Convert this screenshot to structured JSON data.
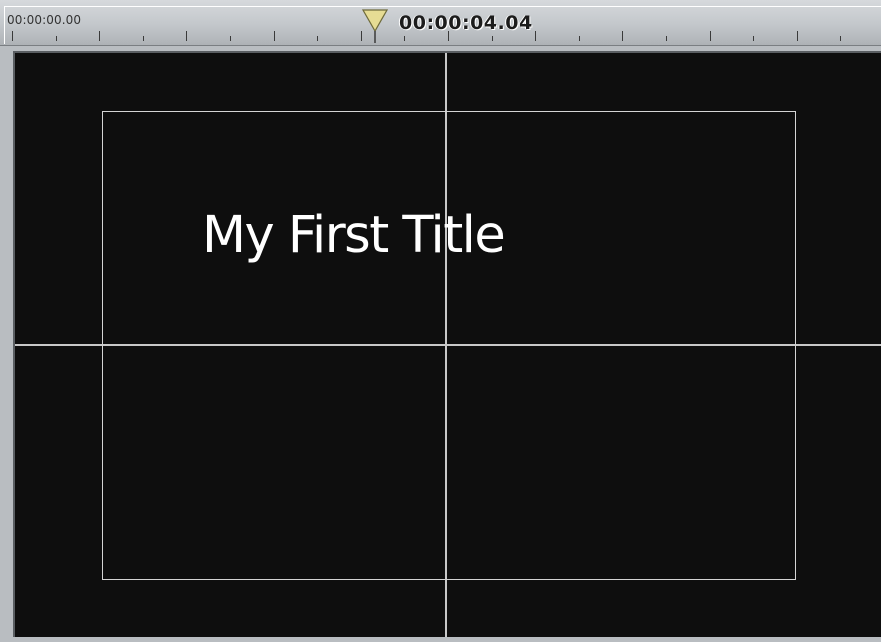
{
  "timeline": {
    "start_timecode": "00:00:00.00",
    "current_timecode": "00:00:04.04"
  },
  "preview": {
    "title_text": "My First Title"
  },
  "colors": {
    "preview_background": "#0e0e0e",
    "guide_lines": "#c8c8c8",
    "playhead": "#e0d890",
    "ruler": "#c3c7cb"
  },
  "icons": {
    "playhead": "playhead-marker-icon"
  }
}
